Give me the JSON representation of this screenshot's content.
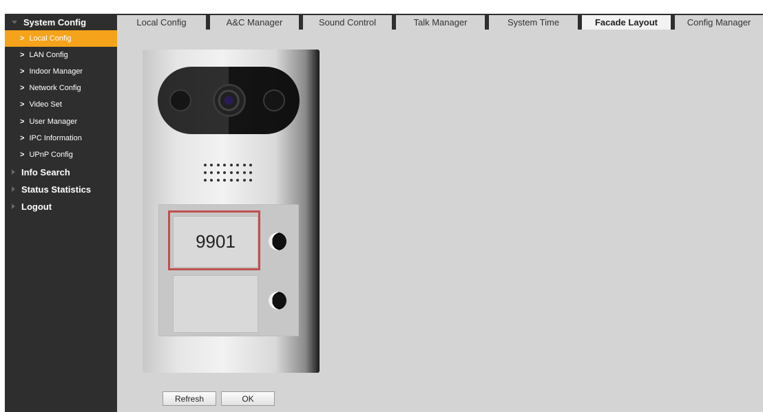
{
  "sidebar": {
    "sections": [
      {
        "label": "System Config",
        "open": true
      },
      {
        "label": "Info Search",
        "open": false
      },
      {
        "label": "Status Statistics",
        "open": false
      },
      {
        "label": "Logout",
        "open": false
      }
    ],
    "items": [
      {
        "label": "Local Config",
        "active": true
      },
      {
        "label": "LAN Config"
      },
      {
        "label": "Indoor Manager"
      },
      {
        "label": "Network Config"
      },
      {
        "label": "Video Set"
      },
      {
        "label": "User Manager"
      },
      {
        "label": "IPC Information"
      },
      {
        "label": "UPnP Config"
      }
    ]
  },
  "tabs": [
    {
      "label": "Local Config"
    },
    {
      "label": "A&C Manager"
    },
    {
      "label": "Sound Control"
    },
    {
      "label": "Talk Manager"
    },
    {
      "label": "System Time"
    },
    {
      "label": "Facade Layout",
      "active": true
    },
    {
      "label": "Config Manager"
    }
  ],
  "facade": {
    "room_number": "9901"
  },
  "buttons": {
    "refresh": "Refresh",
    "ok": "OK"
  },
  "colors": {
    "sidebar_bg": "#2e2e2e",
    "active_item": "#f5a31a",
    "content_bg": "#d4d4d4",
    "highlight_border": "#c0504d"
  }
}
